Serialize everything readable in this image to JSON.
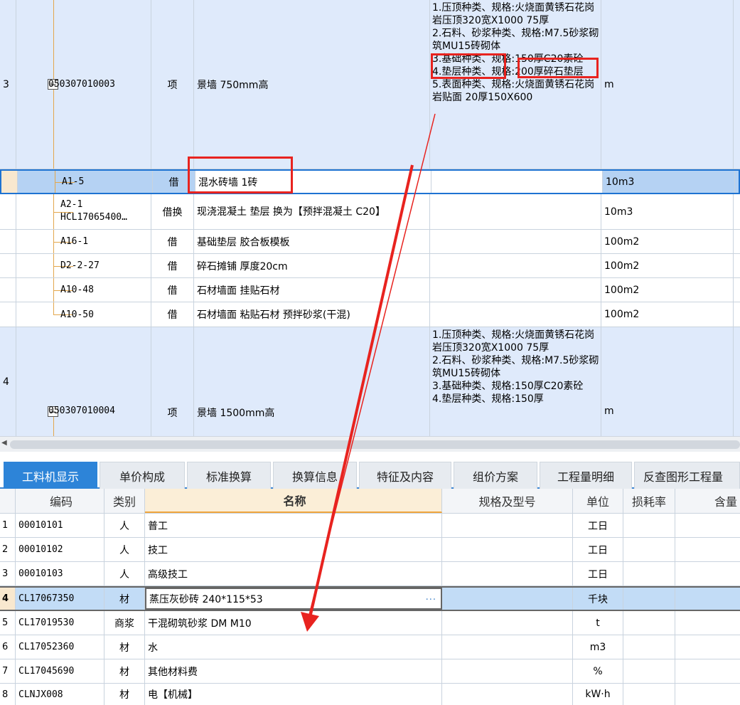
{
  "upper_rows": [
    {
      "index": "3",
      "code": "050307010003",
      "type": "项",
      "name": "景墙 750mm高",
      "features": "1.压顶种类、规格:火烧面黄锈石花岗岩压顶320宽X1000 75厚\n2.石料、砂浆种类、规格:M7.5砂浆砌筑MU15砖砌体\n3.基础种类、规格:150厚C20素砼\n4.垫层种类、规格:200厚碎石垫层\n5.表面种类、规格:火烧面黄锈石花岗岩贴面 20厚150X600",
      "unit": "m"
    },
    {
      "index": "",
      "code": "A1-5",
      "type": "借",
      "name": "混水砖墙 1砖",
      "unit": "10m3"
    },
    {
      "index": "",
      "code": "A2-1",
      "code2": "HCL17065400…",
      "type": "借换",
      "name": "现浇混凝土 垫层  换为【预拌混凝土 C20】",
      "unit": "10m3"
    },
    {
      "index": "",
      "code": "A16-1",
      "type": "借",
      "name": "基础垫层 胶合板模板",
      "unit": "100m2"
    },
    {
      "index": "",
      "code": "D2-2-27",
      "type": "借",
      "name": "碎石摊铺 厚度20cm",
      "unit": "100m2"
    },
    {
      "index": "",
      "code": "A10-48",
      "type": "借",
      "name": "石材墙面 挂贴石材",
      "unit": "100m2"
    },
    {
      "index": "",
      "code": "A10-50",
      "type": "借",
      "name": "石材墙面 粘贴石材 预拌砂浆(干混)",
      "unit": "100m2"
    },
    {
      "index": "4",
      "code": "050307010004",
      "type": "项",
      "name": "景墙 1500mm高",
      "features": "1.压顶种类、规格:火烧面黄锈石花岗岩压顶320宽X1000 75厚\n2.石料、砂浆种类、规格:M7.5砂浆砌筑MU15砖砌体\n3.基础种类、规格:150厚C20素砼\n4.垫层种类、规格:150厚",
      "unit": "m"
    }
  ],
  "tabs": [
    "工料机显示",
    "单价构成",
    "标准换算",
    "换算信息",
    "特征及内容",
    "组价方案",
    "工程量明细",
    "反查图形工程量"
  ],
  "lower_headers": [
    "编码",
    "类别",
    "名称",
    "规格及型号",
    "单位",
    "损耗率",
    "含量"
  ],
  "lower_rows": [
    {
      "index": "1",
      "code": "00010101",
      "cat": "人",
      "name": "普工",
      "unit": "工日"
    },
    {
      "index": "2",
      "code": "00010102",
      "cat": "人",
      "name": "技工",
      "unit": "工日"
    },
    {
      "index": "3",
      "code": "00010103",
      "cat": "人",
      "name": "高级技工",
      "unit": "工日"
    },
    {
      "index": "4",
      "code": "CL17067350",
      "cat": "材",
      "name": "蒸压灰砂砖 240*115*53",
      "unit": "千块",
      "extra": "···"
    },
    {
      "index": "5",
      "code": "CL17019530",
      "cat": "商浆",
      "name": "干混砌筑砂浆 DM M10",
      "unit": "t"
    },
    {
      "index": "6",
      "code": "CL17052360",
      "cat": "材",
      "name": "水",
      "unit": "m3"
    },
    {
      "index": "7",
      "code": "CL17045690",
      "cat": "材",
      "name": "其他材料费",
      "unit": "%"
    },
    {
      "index": "8",
      "code": "CLNJX008",
      "cat": "材",
      "name": "电【机械】",
      "unit": "kW·h"
    }
  ],
  "colors": {
    "highlight": "#e8231f",
    "tab_active": "#2d84d8",
    "section_row": "#dfeafb",
    "selected_row": "#b5d2f3"
  }
}
